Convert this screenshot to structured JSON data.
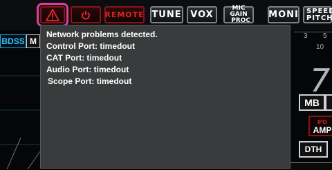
{
  "toolbar": {
    "remote_label": "REMOTE",
    "tune_label": "TUNE",
    "vox_label": "VOX",
    "mic_gain_line1": "MIC GAIN",
    "mic_gain_line2": "PROC",
    "moni_label": "MONI",
    "speed_line1": "SPEED",
    "speed_line2": "PITCH"
  },
  "left": {
    "bdss_label": "BDSS",
    "m_label": "M"
  },
  "right": {
    "scale_left": "3",
    "scale_right": "5",
    "scale_sub": "10",
    "big_digit": "7",
    "mb_label": "MB",
    "ipo_label": "IPO",
    "amp_label": "AMP",
    "dth_label": "DTH"
  },
  "popup": {
    "lines": [
      "Network problems detected.",
      "Control Port: timedout",
      "CAT Port: timedout",
      "Audio Port: timedout",
      "Scope Port: timedout"
    ]
  },
  "colors": {
    "highlight": "#e23aa0",
    "alert_red": "#e02424",
    "accent_cyan": "#3cc4ff",
    "popup_bg": "#3a3b3c"
  }
}
